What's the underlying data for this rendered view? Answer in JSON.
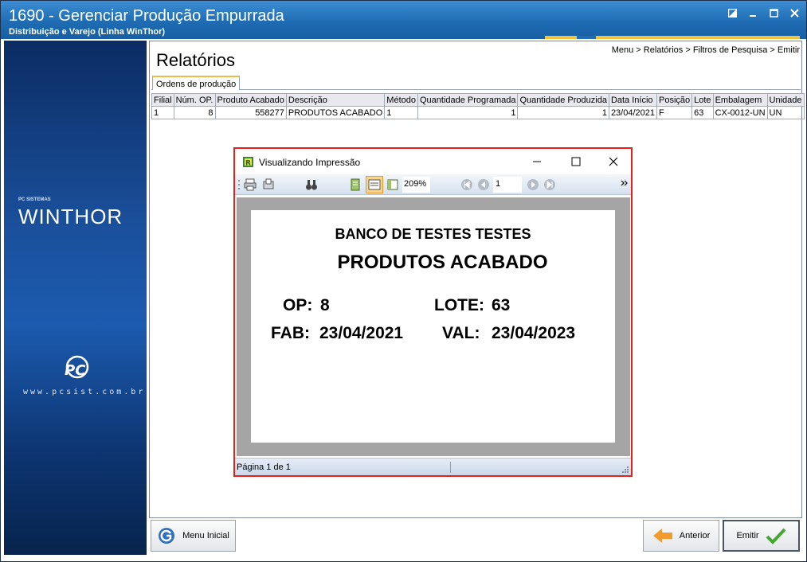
{
  "window": {
    "title": "1690 - Gerenciar Produção Empurrada",
    "subtitle": "Distribuição e Varejo (Linha WinThor)"
  },
  "sidebar": {
    "brand_small": "PC SISTEMAS",
    "brand": "WINTHOR",
    "url": "www.pcsist.com.br"
  },
  "breadcrumb": "Menu > Relatórios > Filtros de Pesquisa > Emitir",
  "page_title": "Relatórios",
  "tab_label": "Ordens de produção",
  "table": {
    "columns": [
      "Filial",
      "Núm. OP.",
      "Produto Acabado",
      "Descrição",
      "Método",
      "Quantidade Programada",
      "Quantidade Produzida",
      "Data Início",
      "Posição",
      "Lote",
      "Embalagem",
      "Unidade"
    ],
    "rows": [
      [
        "1",
        "8",
        "558277",
        "PRODUTOS ACABADO",
        "1",
        "1",
        "1",
        "23/04/2021",
        "F",
        "63",
        "CX-0012-UN",
        "UN"
      ]
    ]
  },
  "buttons": {
    "menu": "Menu Inicial",
    "prev": "Anterior",
    "emit": "Emitir"
  },
  "dialog": {
    "title": "Visualizando Impressão",
    "zoom": "209%",
    "page_input": "1",
    "status": "Página 1 de 1",
    "report": {
      "line1": "BANCO DE TESTES TESTES",
      "line2": "PRODUTOS ACABADO",
      "op_label": "OP:",
      "op_value": "8",
      "lote_label": "LOTE:",
      "lote_value": "63",
      "fab_label": "FAB:",
      "fab_value": "23/04/2021",
      "val_label": "VAL:",
      "val_value": "23/04/2023"
    }
  },
  "colors": {
    "title_blue": "#1f6cb3",
    "accent_yellow": "#f2c23a",
    "dialog_border": "#e0211c"
  }
}
